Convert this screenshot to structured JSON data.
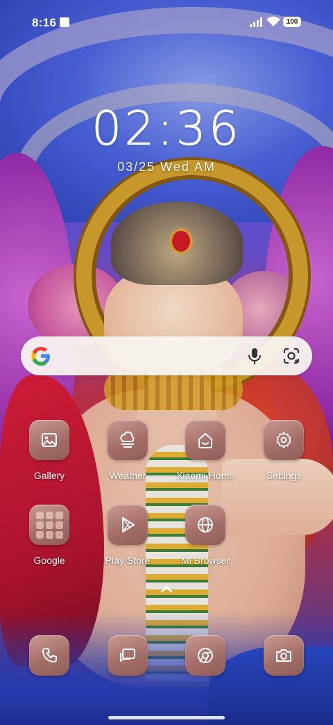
{
  "status_bar": {
    "time": "8:16",
    "battery": "100",
    "icons": [
      "notification-icon",
      "signal-icon",
      "wifi-icon",
      "battery-icon"
    ]
  },
  "lockclock": {
    "time": "02:36",
    "date": "03/25 Wed AM"
  },
  "search": {
    "logo": "google-logo",
    "mic_icon": "mic-icon",
    "lens_icon": "google-lens-icon"
  },
  "apps": {
    "row1": [
      {
        "label": "Gallery",
        "icon": "gallery-icon"
      },
      {
        "label": "Weather",
        "icon": "weather-icon"
      },
      {
        "label": "Xiaomi Home",
        "icon": "xiaomi-home-icon"
      },
      {
        "label": "Settings",
        "icon": "settings-icon"
      }
    ],
    "row2": [
      {
        "label": "Google",
        "icon": "folder-icon"
      },
      {
        "label": "Play Store",
        "icon": "play-store-icon"
      },
      {
        "label": "Mi Browser",
        "icon": "browser-icon"
      }
    ]
  },
  "dock": [
    {
      "icon": "phone-icon"
    },
    {
      "icon": "messages-icon"
    },
    {
      "icon": "chrome-icon"
    },
    {
      "icon": "camera-icon"
    }
  ],
  "colors": {
    "icon_tile": "#a56f69",
    "search_bg": "#f8f4f0"
  }
}
